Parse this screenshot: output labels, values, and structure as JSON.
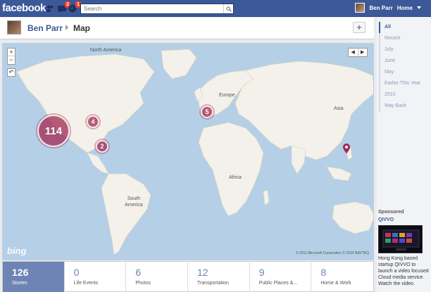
{
  "topbar": {
    "logo": "facebook",
    "friend_requests_badge": "",
    "messages_badge": "2",
    "notifications_badge": "1",
    "search_placeholder": "Search",
    "user_name": "Ben Parr",
    "home_label": "Home"
  },
  "header": {
    "profile_name": "Ben Parr",
    "section_title": "Map",
    "add_label": "+"
  },
  "map": {
    "labels": [
      "North America",
      "Europe",
      "Asia",
      "Africa",
      "South America"
    ],
    "clusters": [
      {
        "count": "114"
      },
      {
        "count": "4"
      },
      {
        "count": "2"
      },
      {
        "count": "5"
      }
    ],
    "provider": "bing",
    "copyright": "© 2011 Microsoft Corporation   © 2010 NAVTEQ",
    "zoom_in": "+",
    "zoom_out": "−",
    "reset": "↶"
  },
  "stats": [
    {
      "count": "126",
      "label": "Stories",
      "active": true
    },
    {
      "count": "0",
      "label": "Life Events"
    },
    {
      "count": "6",
      "label": "Photos"
    },
    {
      "count": "12",
      "label": "Transportation"
    },
    {
      "count": "9",
      "label": "Public Places &..."
    },
    {
      "count": "8",
      "label": "Home & Work"
    }
  ],
  "sidebar": {
    "timeline": [
      "All",
      "Recent",
      "July",
      "June",
      "May",
      "Earlier This Year",
      "2010",
      "Way Back"
    ],
    "sponsored_label": "Sponsored",
    "ad_title": "QIVVO",
    "ad_text": "Hong Kong based startup QIVVO to launch a video focused Cloud media service. Watch the video."
  },
  "colors": {
    "brand": "#3b5998",
    "cluster": "#a02850",
    "water": "#b5d0e6",
    "land": "#f4f1ea"
  }
}
